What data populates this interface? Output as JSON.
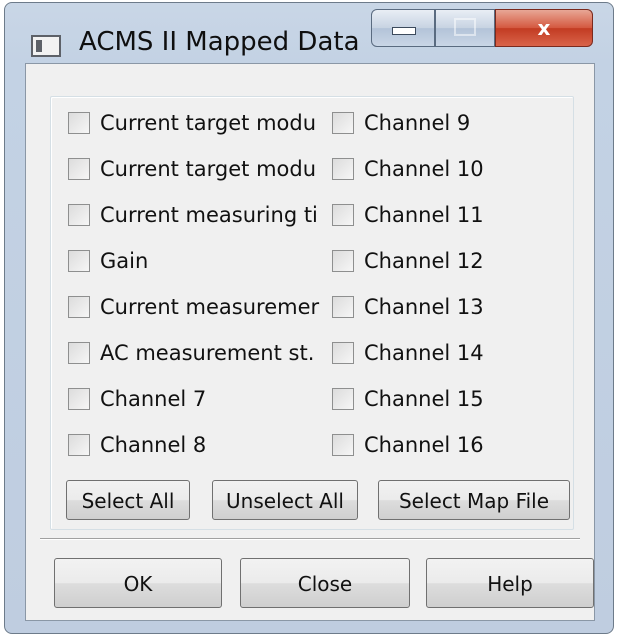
{
  "window": {
    "title": "ACMS II Mapped Data",
    "icon": "app-window-icon",
    "caption_buttons": {
      "minimize": "minimize-icon",
      "maximize": "maximize-icon",
      "close": "x"
    }
  },
  "checkboxes_left": [
    {
      "label": "Current target modu",
      "checked": false
    },
    {
      "label": "Current target modu",
      "checked": false
    },
    {
      "label": "Current measuring ti",
      "checked": false
    },
    {
      "label": "Gain",
      "checked": false
    },
    {
      "label": "Current measuremer",
      "checked": false
    },
    {
      "label": "AC measurement st.",
      "checked": false
    },
    {
      "label": "Channel 7",
      "checked": false
    },
    {
      "label": "Channel 8",
      "checked": false
    }
  ],
  "checkboxes_right": [
    {
      "label": "Channel 9",
      "checked": false
    },
    {
      "label": "Channel 10",
      "checked": false
    },
    {
      "label": "Channel 11",
      "checked": false
    },
    {
      "label": "Channel 12",
      "checked": false
    },
    {
      "label": "Channel 13",
      "checked": false
    },
    {
      "label": "Channel 14",
      "checked": false
    },
    {
      "label": "Channel 15",
      "checked": false
    },
    {
      "label": "Channel 16",
      "checked": false
    }
  ],
  "buttons": {
    "select_all": "Select All",
    "unselect_all": "Unselect All",
    "select_map_file": "Select Map File",
    "ok": "OK",
    "close": "Close",
    "help": "Help"
  },
  "colors": {
    "frame": "#c3d2e4",
    "client": "#f0f0f0",
    "close_button": "#c9462c"
  }
}
